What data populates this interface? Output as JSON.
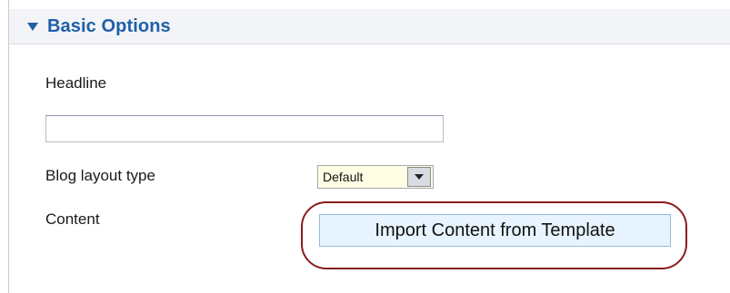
{
  "section": {
    "title": "Basic Options",
    "toggle_icon": "triangle-down-icon"
  },
  "fields": {
    "headline": {
      "label": "Headline",
      "value": "",
      "placeholder": ""
    },
    "blog_layout_type": {
      "label": "Blog layout type",
      "selected": "Default",
      "dropdown_icon": "triangle-down-icon"
    },
    "content": {
      "label": "Content",
      "button_label": "Import Content from Template"
    }
  },
  "colors": {
    "header_text": "#1f5fa8",
    "header_bg": "#f2f4f7",
    "select_bg": "#fffee5",
    "button_bg": "#e7f4ff",
    "button_border": "#97b9d9",
    "highlight_ring": "#8a1c1c"
  }
}
